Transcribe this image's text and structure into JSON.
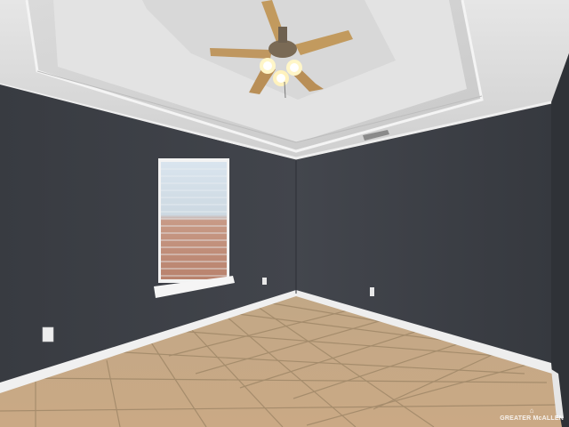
{
  "scene": {
    "description_type": "empty-room-photo",
    "watermark": {
      "text": "GREATER McALLEN",
      "icon": "realtor-house-icon"
    },
    "colors": {
      "wall": "#3b3e45",
      "wall_right": "#35383e",
      "ceiling": "#dcdcdc",
      "tray_ceiling": "#d2d2d2",
      "floor_tile": "#c7ad8a",
      "grout": "#9c8466",
      "trim": "#f2f2f2"
    }
  }
}
